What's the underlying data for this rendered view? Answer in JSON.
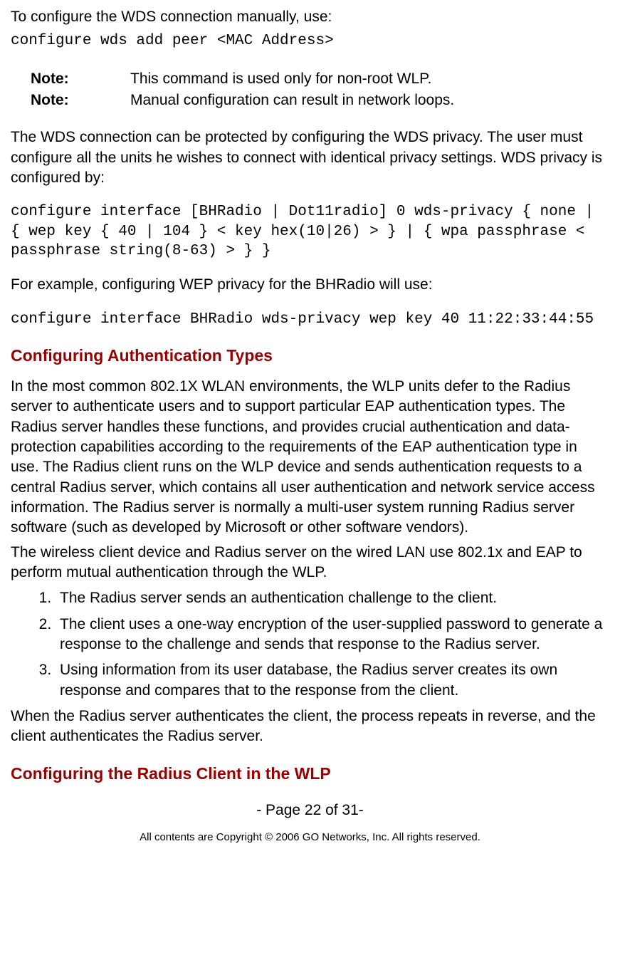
{
  "intro1": "To configure the WDS connection manually, use:",
  "cmd1": "configure wds add peer <MAC Address>",
  "notes": [
    {
      "label": "Note:",
      "text": "This command is used only for non-root WLP."
    },
    {
      "label": "Note:",
      "text": "Manual configuration can result in network loops."
    }
  ],
  "para2": "The WDS connection can be protected by configuring the WDS privacy. The user must configure all the units he wishes to connect with identical privacy settings. WDS privacy is configured by:",
  "cmd2": "configure interface [BHRadio | Dot11radio] 0 wds-privacy { none | { wep key { 40 | 104 } < key hex(10|26) > } | { wpa passphrase < passphrase string(8-63) > } }",
  "para3": "For example, configuring WEP privacy for the BHRadio will use:",
  "cmd3": "configure interface BHRadio wds-privacy wep key 40 11:22:33:44:55",
  "heading1": "Configuring Authentication Types",
  "para4": "In the most common 802.1X WLAN environments, the WLP units defer to the Radius server to authenticate users and to support particular EAP authentication types. The Radius server handles these functions, and provides crucial authentication and data-protection capabilities according to the requirements of the EAP authentication type in use. The Radius client runs on the WLP device and sends authentication requests to a central Radius server, which contains all user authentication and network service access information. The Radius server is normally a multi-user system running Radius server software (such as developed by Microsoft or other software vendors).",
  "para5": "The wireless client device and Radius server on the wired LAN use 802.1x and EAP to perform mutual authentication through the WLP.",
  "list": [
    "The Radius server sends an authentication challenge to the client.",
    "The client uses a one-way encryption of the user-supplied password to generate a response to the challenge and sends that response to the Radius server.",
    "Using information from its user database, the Radius server creates its own response and compares that to the response from the client."
  ],
  "para6": "When the Radius server authenticates the client, the process repeats in reverse, and the client authenticates the Radius server.",
  "heading2": "Configuring the Radius Client in the WLP",
  "pageNum": "- Page 22 of 31-",
  "copyright": "All contents are Copyright © 2006 GO Networks, Inc. All rights reserved."
}
